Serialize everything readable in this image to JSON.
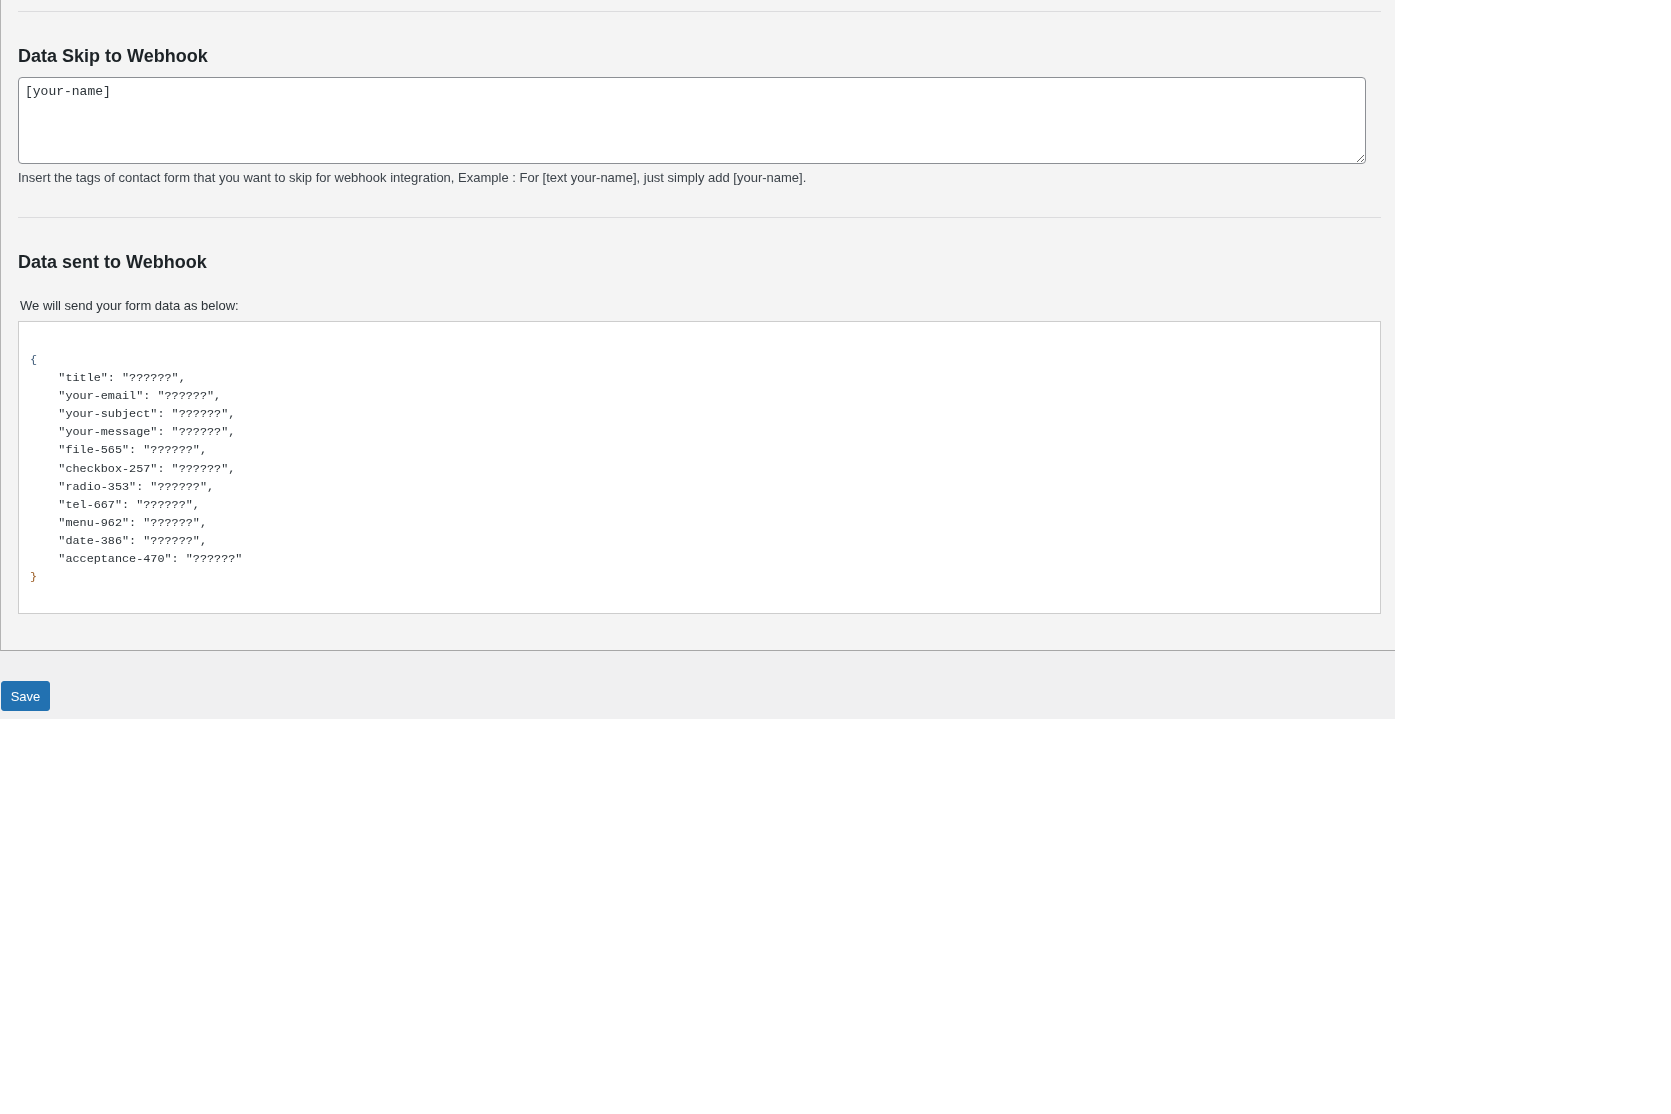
{
  "sections": [
    {
      "kind": "textarea",
      "heading": "Data Skip to Webhook",
      "field": {
        "value": "[your-name]"
      },
      "help": "Insert the tags of contact form that you want to skip for webhook integration, Example : For [text your-name], just simply add [your-name]."
    },
    {
      "kind": "preview",
      "heading": "Data sent to Webhook",
      "label": "We will send your form data as below:",
      "code_lines": [
        "{",
        "    \"title\": \"??????\",",
        "    \"your-email\": \"??????\",",
        "    \"your-subject\": \"??????\",",
        "    \"your-message\": \"??????\",",
        "    \"file-565\": \"??????\",",
        "    \"checkbox-257\": \"??????\",",
        "    \"radio-353\": \"??????\",",
        "    \"tel-667\": \"??????\",",
        "    \"menu-962\": \"??????\",",
        "    \"date-386\": \"??????\",",
        "    \"acceptance-470\": \"??????\"",
        "}"
      ]
    }
  ],
  "save_button": "Save"
}
